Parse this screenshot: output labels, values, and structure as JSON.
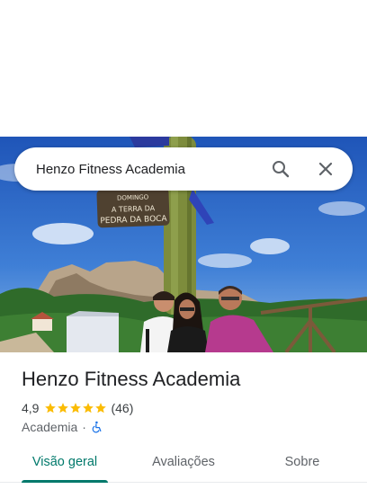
{
  "search": {
    "query": "Henzo Fitness Academia",
    "search_icon": "search-icon",
    "close_icon": "close-icon"
  },
  "photo": {
    "sign_text": [
      "DOMINGO",
      "A TERRA DA",
      "PEDRA DA BOCA"
    ]
  },
  "place": {
    "name": "Henzo Fitness Academia",
    "rating": "4,9",
    "rating_value": 4.9,
    "stars": 5,
    "review_count": "(46)",
    "category": "Academia",
    "separator": "·",
    "accessibility_icon": "wheelchair-icon"
  },
  "tabs": [
    {
      "label": "Visão geral",
      "active": true
    },
    {
      "label": "Avaliações",
      "active": false
    },
    {
      "label": "Sobre",
      "active": false
    }
  ],
  "colors": {
    "accent": "#00796b",
    "star": "#fbbc04",
    "accessibility": "#1a73e8"
  }
}
